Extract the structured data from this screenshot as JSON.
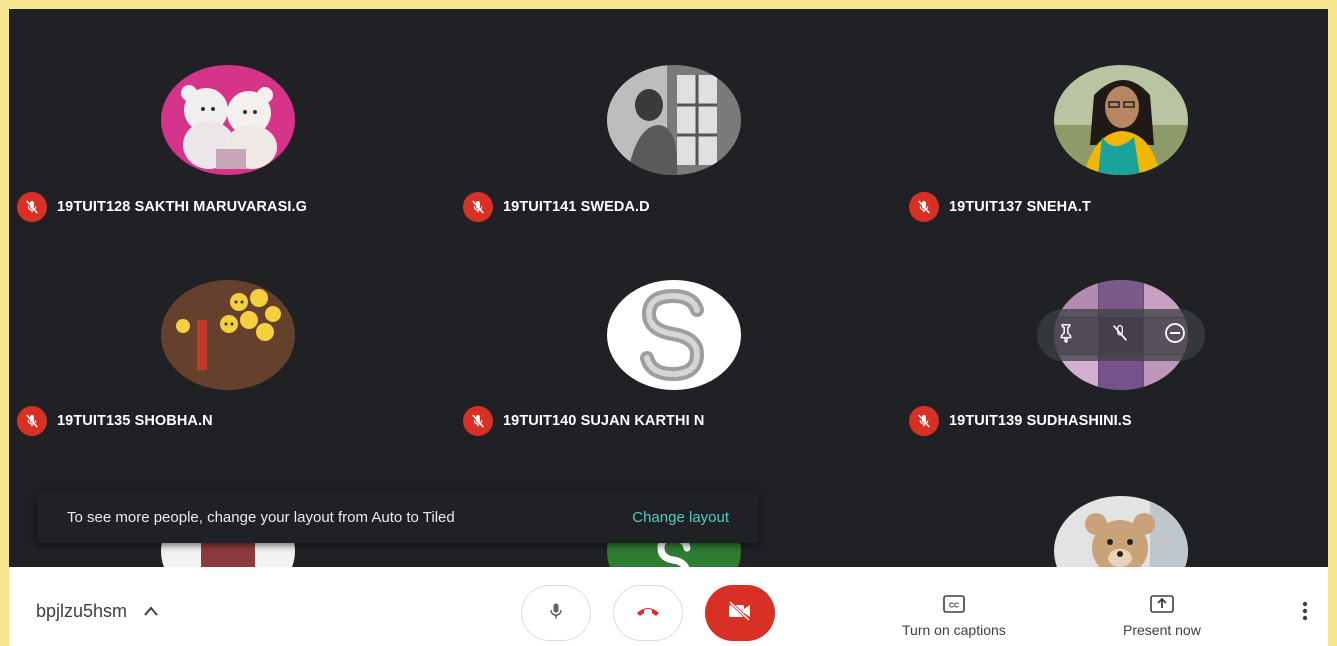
{
  "participants": [
    {
      "name": "19TUIT128 SAKTHI MARUVARASI.G",
      "muted": true,
      "avatar": "teddy-bears-pink"
    },
    {
      "name": "19TUIT141 SWEDA.D",
      "muted": true,
      "avatar": "bw-window-photo"
    },
    {
      "name": "19TUIT137 SNEHA.T",
      "muted": true,
      "avatar": "girl-portrait"
    },
    {
      "name": "19TUIT135 SHOBHA.N",
      "muted": true,
      "avatar": "emoji-balls"
    },
    {
      "name": "19TUIT140 SUJAN KARTHI N",
      "muted": true,
      "avatar": "letter-s-glitter"
    },
    {
      "name": "19TUIT139 SUDHASHINI.S",
      "muted": true,
      "avatar": "collage"
    }
  ],
  "partial_tiles": [
    "person-partial",
    "green-s-partial",
    "teddy-partial"
  ],
  "toast": {
    "message": "To see more people, change your layout from Auto to Tiled",
    "action": "Change layout"
  },
  "bottom_bar": {
    "meeting_code": "bpjlzu5hsm",
    "captions_label": "Turn on captions",
    "present_label": "Present now"
  },
  "colors": {
    "frame_border": "#f6e58d",
    "stage_bg": "#202124",
    "danger": "#d93025",
    "accent": "#4ecdc4"
  }
}
